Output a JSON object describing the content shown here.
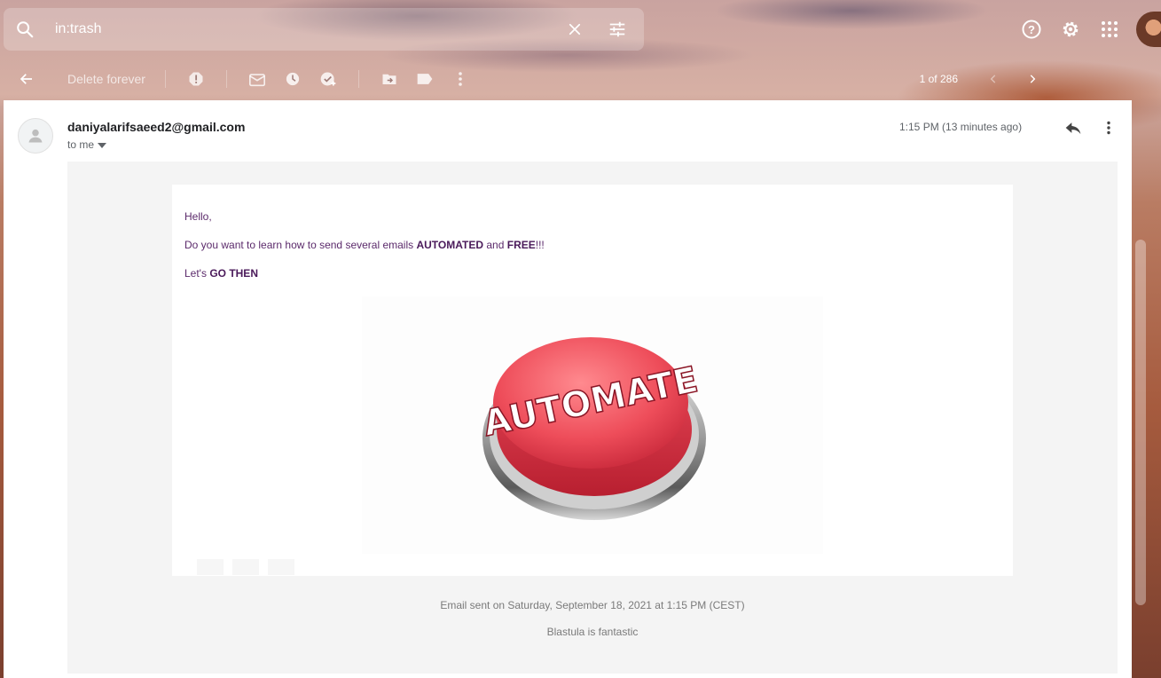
{
  "search": {
    "value": "in:trash"
  },
  "toolbar": {
    "delete_forever": "Delete forever",
    "pagination": "1 of 286"
  },
  "email": {
    "sender": "daniyalarifsaeed2@gmail.com",
    "to": "to me",
    "time": "1:15 PM (13 minutes ago)",
    "greeting": "Hello,",
    "line1_pre": "Do you want to learn how to send several emails ",
    "line1_bold1": "AUTOMATED",
    "line1_mid": " and ",
    "line1_bold2": "FREE",
    "line1_post": "!!!",
    "line2_pre": "Let's ",
    "line2_bold": "GO THEN",
    "image_text": "AUTOMATE",
    "footer_sent": "Email sent on Saturday, September 18, 2021 at 1:15 PM (CEST)",
    "footer_tag": "Blastula is fantastic"
  },
  "colors": {
    "body_text": "#5b2a6b",
    "button_red": "#e8485a"
  },
  "icons": [
    "search-icon",
    "clear-icon",
    "search-options-icon",
    "help-icon",
    "settings-icon",
    "apps-icon",
    "back-icon",
    "report-spam-icon",
    "mark-unread-icon",
    "snooze-icon",
    "add-task-icon",
    "move-to-icon",
    "label-icon",
    "more-icon",
    "older-icon",
    "newer-icon",
    "reply-icon",
    "dropdown-icon",
    "person-icon"
  ]
}
